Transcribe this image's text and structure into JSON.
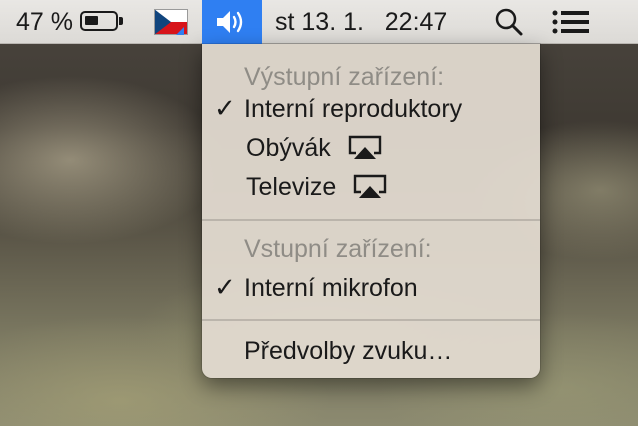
{
  "menubar": {
    "battery_percent": "47 %",
    "battery_level": 0.47,
    "input_source_icon": "czech-flag-icon",
    "volume_icon": "speaker-volume-icon",
    "clock": "st 13. 1.   22:47",
    "search_icon": "magnifier-icon",
    "notification_icon": "list-icon",
    "highlight_color": "#2f7ff2"
  },
  "menu": {
    "output_header": "Výstupní zařízení:",
    "output_devices": [
      {
        "label": "Interní reproduktory",
        "checked": true
      },
      {
        "label": "Obývák",
        "icon": "airplay-icon"
      },
      {
        "label": "Televize",
        "icon": "airplay-icon"
      }
    ],
    "input_header": "Vstupní zařízení:",
    "input_devices": [
      {
        "label": "Interní mikrofon",
        "checked": true
      }
    ],
    "preferences": "Předvolby zvuku…",
    "check_glyph": "✓"
  }
}
